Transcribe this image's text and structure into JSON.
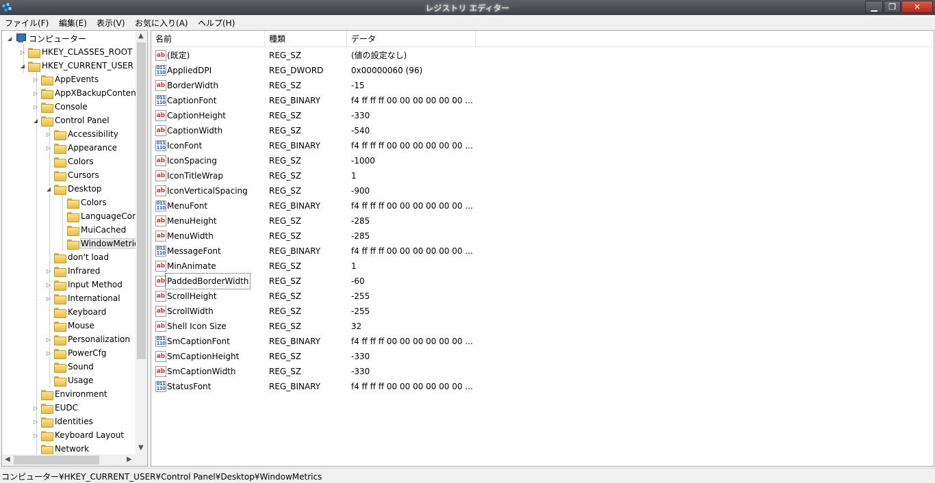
{
  "window": {
    "title": "レジストリ エディター",
    "min": "▁",
    "max": "❐",
    "close": "✕"
  },
  "menu": [
    {
      "label": "ファイル(F)"
    },
    {
      "label": "編集(E)"
    },
    {
      "label": "表示(V)"
    },
    {
      "label": "お気に入り(A)"
    },
    {
      "label": "ヘルプ(H)"
    }
  ],
  "tree": [
    {
      "label": "コンピューター",
      "icon": "computer-icon",
      "expander": "◢"
    },
    {
      "label": "HKEY_CLASSES_ROOT",
      "expander": "▷"
    },
    {
      "label": "HKEY_CURRENT_USER",
      "expander": "◢"
    },
    {
      "label": "AppEvents",
      "expander": "▷"
    },
    {
      "label": "AppXBackupContent",
      "expander": "▷"
    },
    {
      "label": "Console",
      "expander": "▷"
    },
    {
      "label": "Control Panel",
      "expander": "◢"
    },
    {
      "label": "Accessibility",
      "expander": "▷"
    },
    {
      "label": "Appearance",
      "expander": "▷"
    },
    {
      "label": "Colors",
      "expander": ""
    },
    {
      "label": "Cursors",
      "expander": ""
    },
    {
      "label": "Desktop",
      "expander": "◢"
    },
    {
      "label": "Colors",
      "expander": ""
    },
    {
      "label": "LanguageConfiguration",
      "expander": ""
    },
    {
      "label": "MuiCached",
      "expander": ""
    },
    {
      "label": "WindowMetrics",
      "expander": ""
    },
    {
      "label": "don't load",
      "expander": ""
    },
    {
      "label": "Infrared",
      "expander": "▷"
    },
    {
      "label": "Input Method",
      "expander": "▷"
    },
    {
      "label": "International",
      "expander": "▷"
    },
    {
      "label": "Keyboard",
      "expander": ""
    },
    {
      "label": "Mouse",
      "expander": ""
    },
    {
      "label": "Personalization",
      "expander": "▷"
    },
    {
      "label": "PowerCfg",
      "expander": "▷"
    },
    {
      "label": "Sound",
      "expander": ""
    },
    {
      "label": "Usage",
      "expander": ""
    },
    {
      "label": "Environment",
      "expander": ""
    },
    {
      "label": "EUDC",
      "expander": "▷"
    },
    {
      "label": "Identities",
      "expander": "▷"
    },
    {
      "label": "Keyboard Layout",
      "expander": "▷"
    },
    {
      "label": "Network",
      "expander": ""
    }
  ],
  "list": {
    "headers": {
      "name": "名前",
      "type": "種類",
      "data": "データ"
    },
    "rows": [
      {
        "icon": "ab",
        "name": "(既定)",
        "type": "REG_SZ",
        "data": "(値の設定なし)"
      },
      {
        "icon": "bin",
        "name": "AppliedDPI",
        "type": "REG_DWORD",
        "data": "0x00000060 (96)"
      },
      {
        "icon": "ab",
        "name": "BorderWidth",
        "type": "REG_SZ",
        "data": "-15"
      },
      {
        "icon": "bin",
        "name": "CaptionFont",
        "type": "REG_BINARY",
        "data": "f4 ff ff ff 00 00 00 00 00 00 ..."
      },
      {
        "icon": "ab",
        "name": "CaptionHeight",
        "type": "REG_SZ",
        "data": "-330"
      },
      {
        "icon": "ab",
        "name": "CaptionWidth",
        "type": "REG_SZ",
        "data": "-540"
      },
      {
        "icon": "bin",
        "name": "IconFont",
        "type": "REG_BINARY",
        "data": "f4 ff ff ff 00 00 00 00 00 00 ..."
      },
      {
        "icon": "ab",
        "name": "IconSpacing",
        "type": "REG_SZ",
        "data": "-1000"
      },
      {
        "icon": "ab",
        "name": "IconTitleWrap",
        "type": "REG_SZ",
        "data": "1"
      },
      {
        "icon": "ab",
        "name": "IconVerticalSpacing",
        "type": "REG_SZ",
        "data": "-900"
      },
      {
        "icon": "bin",
        "name": "MenuFont",
        "type": "REG_BINARY",
        "data": "f4 ff ff ff 00 00 00 00 00 00 ..."
      },
      {
        "icon": "ab",
        "name": "MenuHeight",
        "type": "REG_SZ",
        "data": "-285"
      },
      {
        "icon": "ab",
        "name": "MenuWidth",
        "type": "REG_SZ",
        "data": "-285"
      },
      {
        "icon": "bin",
        "name": "MessageFont",
        "type": "REG_BINARY",
        "data": "f4 ff ff ff 00 00 00 00 00 00 ..."
      },
      {
        "icon": "ab",
        "name": "MinAnimate",
        "type": "REG_SZ",
        "data": "1"
      },
      {
        "icon": "ab",
        "name": "PaddedBorderWidth",
        "type": "REG_SZ",
        "data": "-60"
      },
      {
        "icon": "ab",
        "name": "ScrollHeight",
        "type": "REG_SZ",
        "data": "-255"
      },
      {
        "icon": "ab",
        "name": "ScrollWidth",
        "type": "REG_SZ",
        "data": "-255"
      },
      {
        "icon": "ab",
        "name": "Shell Icon Size",
        "type": "REG_SZ",
        "data": "32"
      },
      {
        "icon": "bin",
        "name": "SmCaptionFont",
        "type": "REG_BINARY",
        "data": "f4 ff ff ff 00 00 00 00 00 00 ..."
      },
      {
        "icon": "ab",
        "name": "SmCaptionHeight",
        "type": "REG_SZ",
        "data": "-330"
      },
      {
        "icon": "ab",
        "name": "SmCaptionWidth",
        "type": "REG_SZ",
        "data": "-330"
      },
      {
        "icon": "bin",
        "name": "StatusFont",
        "type": "REG_BINARY",
        "data": "f4 ff ff ff 00 00 00 00 00 00 ..."
      }
    ]
  },
  "status": {
    "path": "コンピューター¥HKEY_CURRENT_USER¥Control Panel¥Desktop¥WindowMetrics"
  },
  "colors": {
    "titlebar": "#4a4e54",
    "close": "#c7402f",
    "panel_border": "#acacac"
  }
}
